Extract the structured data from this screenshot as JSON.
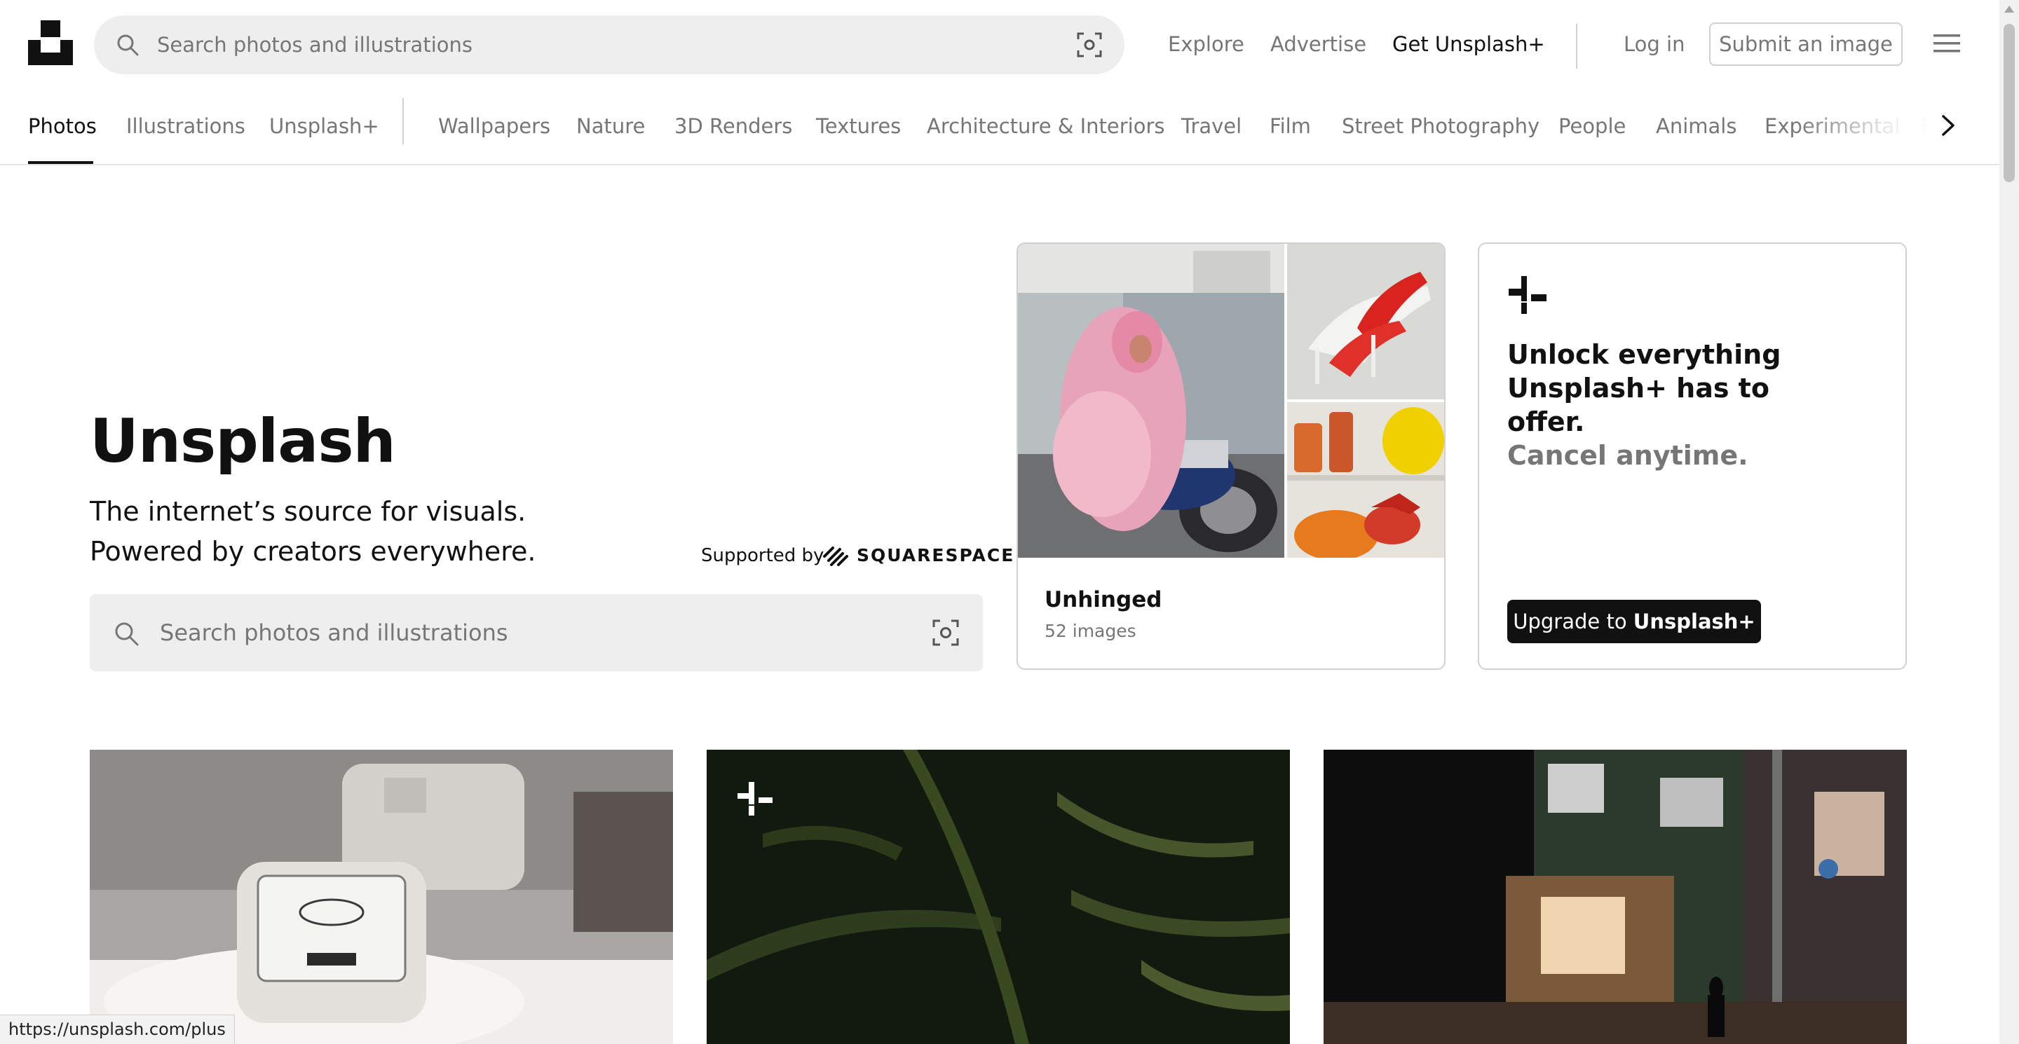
{
  "header": {
    "search_placeholder": "Search photos and illustrations",
    "nav": {
      "explore": "Explore",
      "advertise": "Advertise",
      "get_plus": "Get Unsplash+",
      "login": "Log in",
      "submit": "Submit an image"
    }
  },
  "tabs": {
    "primary": [
      "Photos",
      "Illustrations",
      "Unsplash+"
    ],
    "topics": [
      "Wallpapers",
      "Nature",
      "3D Renders",
      "Textures",
      "Architecture & Interiors",
      "Travel",
      "Film",
      "Street Photography",
      "People",
      "Animals",
      "Experimental",
      "F"
    ]
  },
  "hero": {
    "title": "Unsplash",
    "subtitle_line1": "The internet’s source for visuals.",
    "subtitle_line2": "Powered by creators everywhere.",
    "supported_by": "Supported by",
    "sponsor": "SQUARESPACE",
    "search_placeholder": "Search photos and illustrations"
  },
  "collection": {
    "title": "Unhinged",
    "count": "52 images"
  },
  "plus_card": {
    "line1": "Unlock everything",
    "line2": "Unsplash+ has to",
    "line3": "offer.",
    "line4": "Cancel anytime.",
    "button_prefix": "Upgrade to",
    "button_brand": "Unsplash+"
  },
  "status_bar": {
    "url": "https://unsplash.com/plus"
  },
  "colors": {
    "text": "#111111",
    "muted": "#767676",
    "border": "#d1d1d1",
    "search_bg": "#eeeeee"
  }
}
